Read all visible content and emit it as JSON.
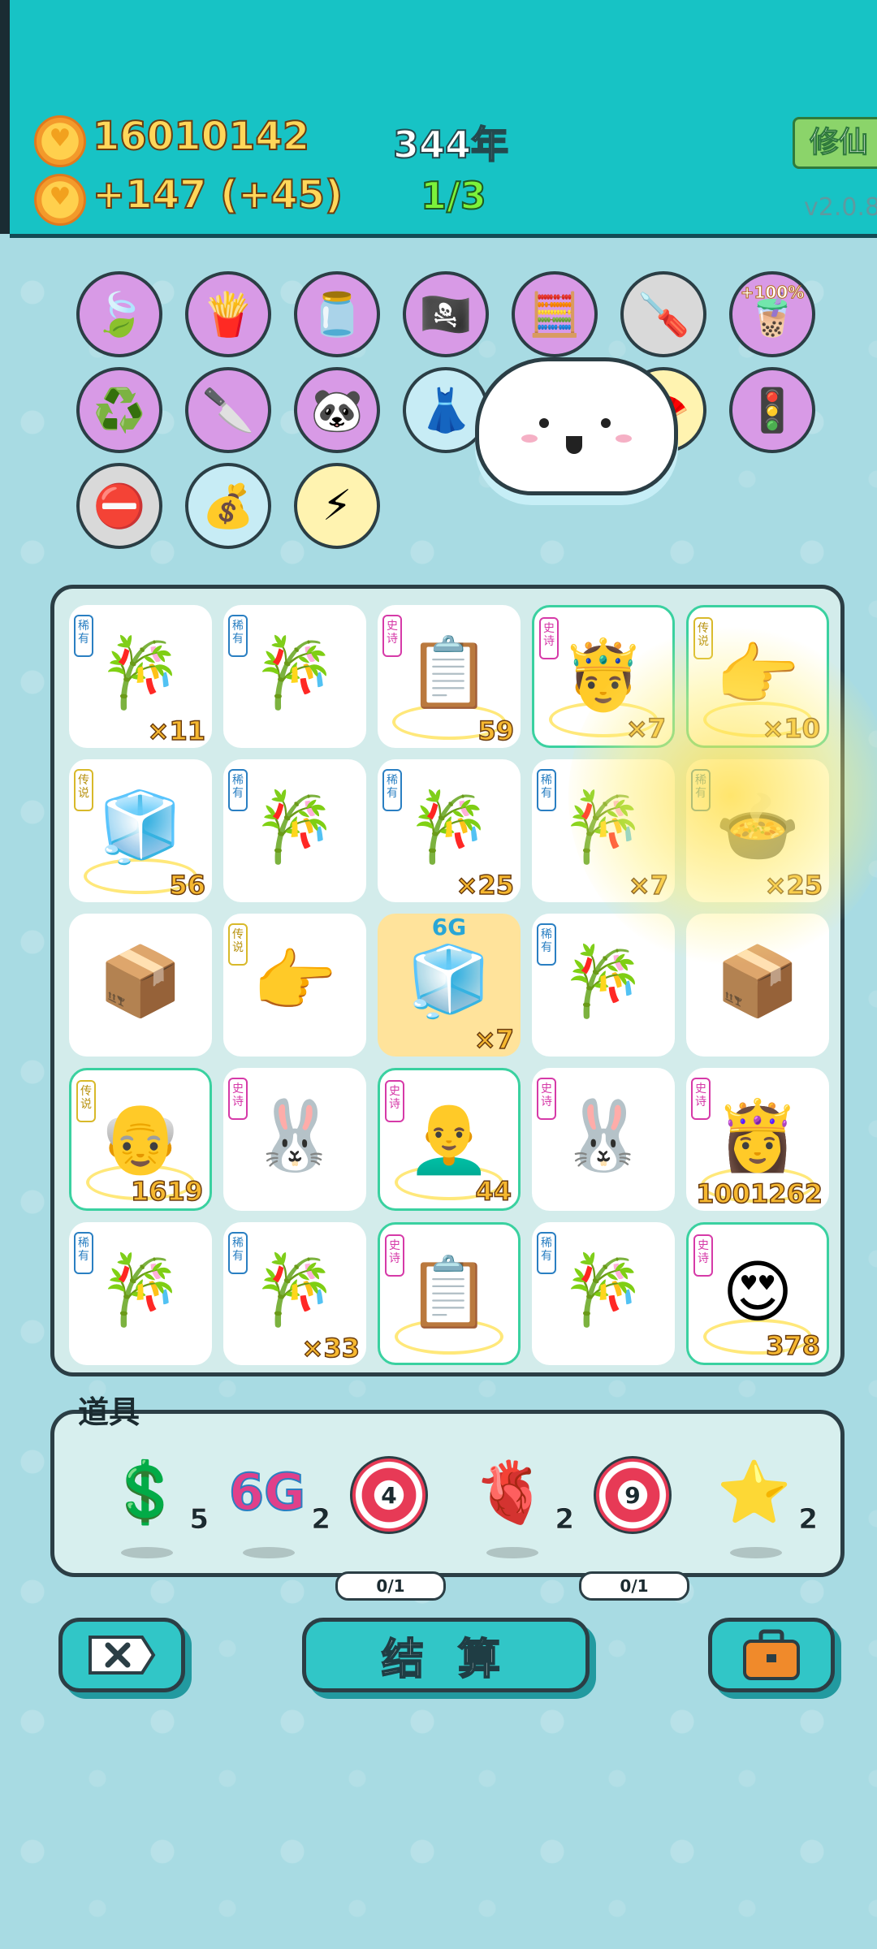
{
  "header": {
    "coins": "16010142",
    "income": "+147 (+45)",
    "year": "344年",
    "progress": "1/3",
    "cultivate_button": "修仙",
    "version": "v2.0.8"
  },
  "skills": [
    {
      "name": "leaf-icon",
      "glyph": "🍃",
      "style": "purple"
    },
    {
      "name": "fries-icon",
      "glyph": "🍟",
      "style": "purple"
    },
    {
      "name": "jar-icon",
      "glyph": "🫙",
      "style": "purple"
    },
    {
      "name": "eyepatch-icon",
      "glyph": "🏴‍☠️",
      "style": "purple"
    },
    {
      "name": "math-face-icon",
      "glyph": "🧮",
      "style": "purple"
    },
    {
      "name": "screwdriver-icon",
      "glyph": "🪛",
      "style": "gray"
    },
    {
      "name": "milk-tea-icon",
      "glyph": "🧋",
      "style": "purple",
      "label": "+100%"
    },
    {
      "name": "recycle-icon",
      "glyph": "♻️",
      "style": "purple"
    },
    {
      "name": "cleaver-icon",
      "glyph": "🔪",
      "style": "purple"
    },
    {
      "name": "panda-icon",
      "glyph": "🐼",
      "style": "purple"
    },
    {
      "name": "skirt-icon",
      "glyph": "👗",
      "style": "blue"
    },
    {
      "name": "fan-icon",
      "glyph": "🪭",
      "style": "yellow"
    },
    {
      "name": "traffic-light-icon",
      "glyph": "🚦",
      "style": "purple"
    },
    {
      "name": "minus-icon",
      "glyph": "⛔",
      "style": "gray"
    },
    {
      "name": "sack-icon",
      "glyph": "💰",
      "style": "blue"
    },
    {
      "name": "lightning-icon",
      "glyph": "⚡",
      "style": "yellow"
    }
  ],
  "board": [
    {
      "tag": "稀有",
      "tag_type": "rare",
      "icon": "🎋",
      "icon_name": "bamboo-icon",
      "count": "×11"
    },
    {
      "tag": "稀有",
      "tag_type": "rare",
      "icon": "🎋",
      "icon_name": "bamboo-icon",
      "count": ""
    },
    {
      "tag": "史诗",
      "tag_type": "epic",
      "icon": "📋",
      "icon_name": "ctrl-cv-icon",
      "count": "59"
    },
    {
      "tag": "史诗",
      "tag_type": "epic",
      "icon": "🤴",
      "icon_name": "prince-icon",
      "count": "×7"
    },
    {
      "tag": "传说",
      "tag_type": "legend",
      "icon": "👉",
      "icon_name": "pointing-hand-icon",
      "count": "×10"
    },
    {
      "tag": "传说",
      "tag_type": "legend",
      "icon": "🧊",
      "icon_name": "fridge-icon",
      "count": "56"
    },
    {
      "tag": "稀有",
      "tag_type": "rare",
      "icon": "🎋",
      "icon_name": "bamboo-icon",
      "count": ""
    },
    {
      "tag": "稀有",
      "tag_type": "rare",
      "icon": "🎋",
      "icon_name": "bamboo-icon",
      "count": "×25"
    },
    {
      "tag": "稀有",
      "tag_type": "rare",
      "icon": "🎋",
      "icon_name": "bamboo-icon",
      "count": "×7"
    },
    {
      "tag": "稀有",
      "tag_type": "rare",
      "icon": "🍲",
      "icon_name": "pot-icon",
      "count": "×25"
    },
    {
      "tag": "",
      "tag_type": "",
      "icon": "📦",
      "icon_name": "box-icon",
      "count": ""
    },
    {
      "tag": "传说",
      "tag_type": "legend",
      "icon": "👉",
      "icon_name": "pointing-hand-icon",
      "count": ""
    },
    {
      "tag": "",
      "tag_type": "",
      "icon": "🧊",
      "icon_name": "fridge-icon",
      "count": "×7",
      "top": "6G"
    },
    {
      "tag": "稀有",
      "tag_type": "rare",
      "icon": "🎋",
      "icon_name": "bamboo-icon",
      "count": ""
    },
    {
      "tag": "",
      "tag_type": "",
      "icon": "📦",
      "icon_name": "box-icon",
      "count": ""
    },
    {
      "tag": "传说",
      "tag_type": "legend",
      "icon": "👴",
      "icon_name": "old-king-icon",
      "count": "1619"
    },
    {
      "tag": "史诗",
      "tag_type": "epic",
      "icon": "🐰",
      "icon_name": "rabbit-tent-icon",
      "count": ""
    },
    {
      "tag": "史诗",
      "tag_type": "epic",
      "icon": "👨‍🦲",
      "icon_name": "glasses-king-icon",
      "count": "44"
    },
    {
      "tag": "史诗",
      "tag_type": "epic",
      "icon": "🐰",
      "icon_name": "rabbit-tent-icon",
      "count": ""
    },
    {
      "tag": "史诗",
      "tag_type": "epic",
      "icon": "👸",
      "icon_name": "princess-icon",
      "count": "1001262"
    },
    {
      "tag": "稀有",
      "tag_type": "rare",
      "icon": "🎋",
      "icon_name": "bamboo-icon",
      "count": ""
    },
    {
      "tag": "稀有",
      "tag_type": "rare",
      "icon": "🎋",
      "icon_name": "bamboo-icon",
      "count": "×33"
    },
    {
      "tag": "史诗",
      "tag_type": "epic",
      "icon": "📋",
      "icon_name": "ctrl-cv-icon",
      "count": ""
    },
    {
      "tag": "稀有",
      "tag_type": "rare",
      "icon": "🎋",
      "icon_name": "bamboo-icon",
      "count": ""
    },
    {
      "tag": "史诗",
      "tag_type": "epic",
      "icon": "😍",
      "icon_name": "heart-eyes-king-icon",
      "count": "378"
    }
  ],
  "props": {
    "title": "道具",
    "items": [
      {
        "name": "dollar-coin-icon",
        "glyph": "💲",
        "count": "5"
      },
      {
        "name": "6g-icon",
        "text": "6G",
        "count": "2"
      },
      {
        "name": "target-4-icon",
        "target": "4",
        "pill": "0/1"
      },
      {
        "name": "liver-icon",
        "glyph": "🫀",
        "count": "2"
      },
      {
        "name": "target-9-icon",
        "target": "9",
        "pill": "0/1"
      },
      {
        "name": "star-icon",
        "glyph": "⭐",
        "count": "2"
      }
    ]
  },
  "buttons": {
    "settle": "结 算"
  }
}
